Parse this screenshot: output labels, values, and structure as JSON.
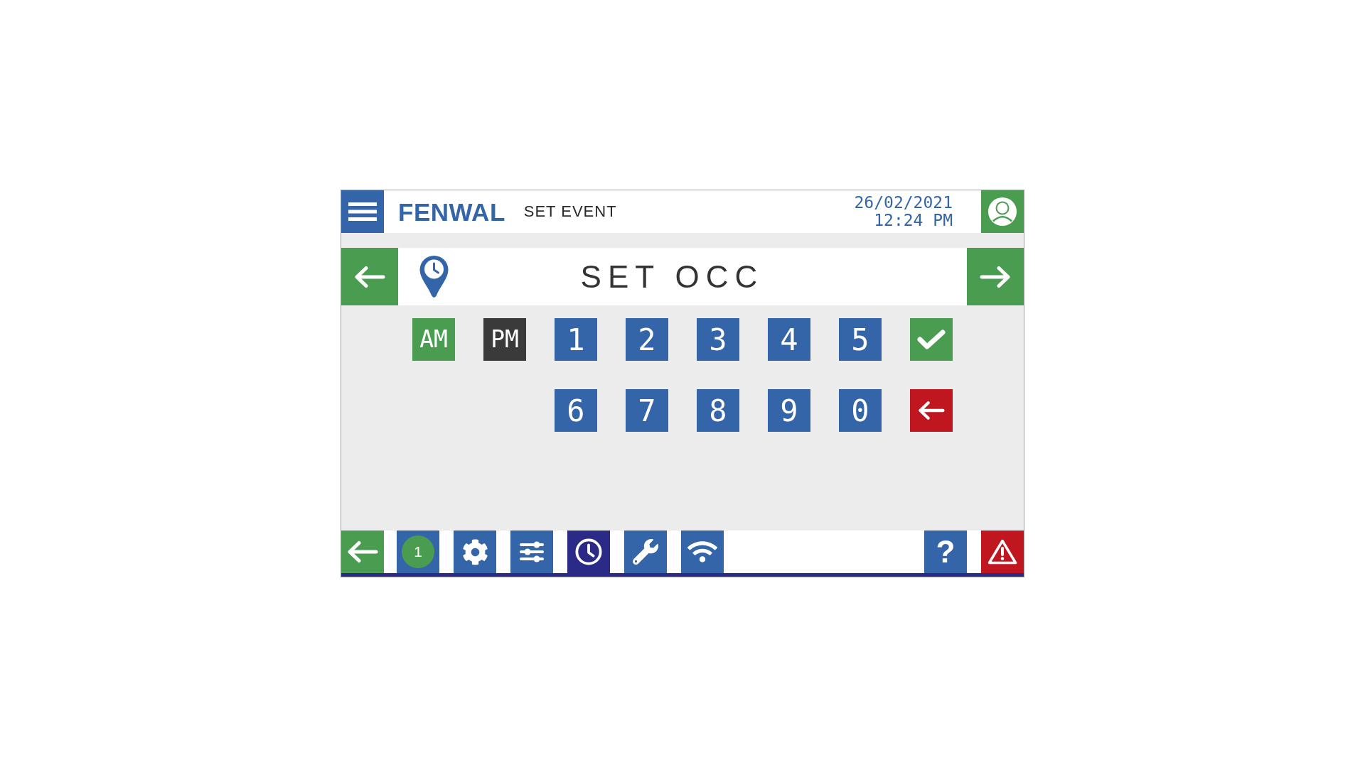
{
  "header": {
    "brand": "FENWAL",
    "screen": "SET EVENT",
    "date": "26/02/2021",
    "time": "12:24 PM"
  },
  "title_bar": {
    "title": "SET OCC"
  },
  "keypad": {
    "rows": [
      [
        {
          "kind": "meridiem",
          "label": "AM",
          "selected": true
        },
        {
          "kind": "meridiem",
          "label": "PM",
          "selected": false
        },
        {
          "kind": "digit",
          "label": "1"
        },
        {
          "kind": "digit",
          "label": "2"
        },
        {
          "kind": "digit",
          "label": "3"
        },
        {
          "kind": "digit",
          "label": "4"
        },
        {
          "kind": "digit",
          "label": "5"
        },
        {
          "kind": "confirm"
        }
      ],
      [
        "",
        "",
        {
          "kind": "digit",
          "label": "6"
        },
        {
          "kind": "digit",
          "label": "7"
        },
        {
          "kind": "digit",
          "label": "8"
        },
        {
          "kind": "digit",
          "label": "9"
        },
        {
          "kind": "digit",
          "label": "0"
        },
        {
          "kind": "backspace"
        }
      ]
    ]
  },
  "nav_bar": {
    "tabs": [
      {
        "kind": "notifications",
        "badge": "1",
        "selected": false
      },
      {
        "kind": "settings",
        "selected": false
      },
      {
        "kind": "adjustments",
        "selected": false
      },
      {
        "kind": "schedule",
        "selected": true
      },
      {
        "kind": "service",
        "selected": false
      },
      {
        "kind": "network",
        "selected": false
      }
    ],
    "help": "?"
  }
}
